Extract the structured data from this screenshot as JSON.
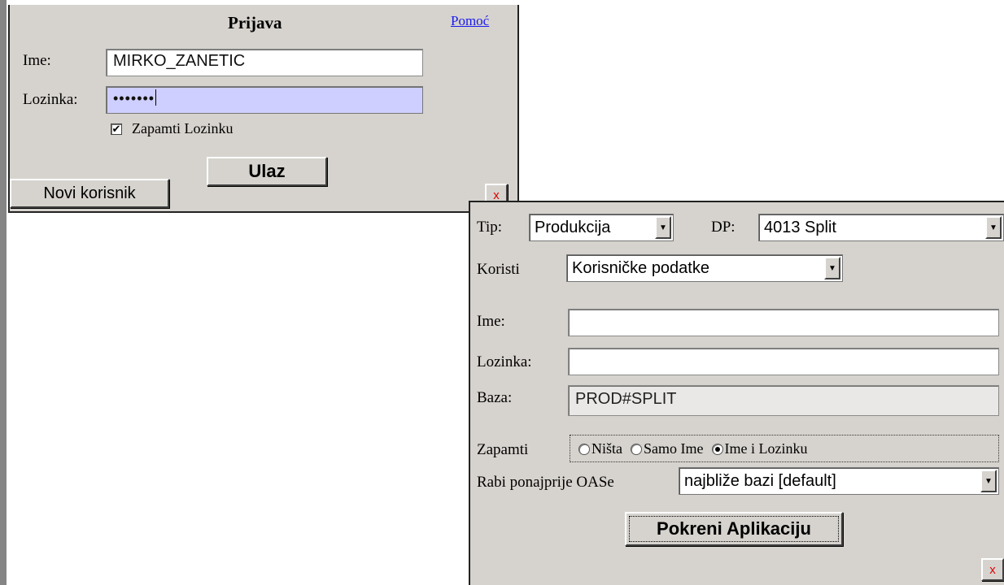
{
  "login": {
    "title": "Prijava",
    "help_link": "Pomoć",
    "name_label": "Ime:",
    "name_value": "MIRKO_ZANETIC",
    "password_label": "Lozinka:",
    "password_value": "•••••••",
    "remember_label": "Zapamti Lozinku",
    "remember_checked": true,
    "submit_label": "Ulaz",
    "new_user_label": "Novi korisnik",
    "close_label": "x"
  },
  "settings": {
    "type_label": "Tip:",
    "type_value": "Produkcija",
    "dp_label": "DP:",
    "dp_value": "4013 Split",
    "use_label": "Koristi",
    "use_value": "Korisničke podatke",
    "name_label": "Ime:",
    "name_value": "",
    "password_label": "Lozinka:",
    "password_value": "",
    "db_label": "Baza:",
    "db_value": "PROD#SPLIT",
    "remember_label": "Zapamti",
    "remember_options": [
      "Ništa",
      "Samo Ime",
      "Ime i Lozinku"
    ],
    "remember_selected": "Ime i Lozinku",
    "oas_label": "Rabi ponajprije OASe",
    "oas_value": "najbliže bazi [default]",
    "launch_label": "Pokreni Aplikaciju",
    "close_label": "x"
  }
}
